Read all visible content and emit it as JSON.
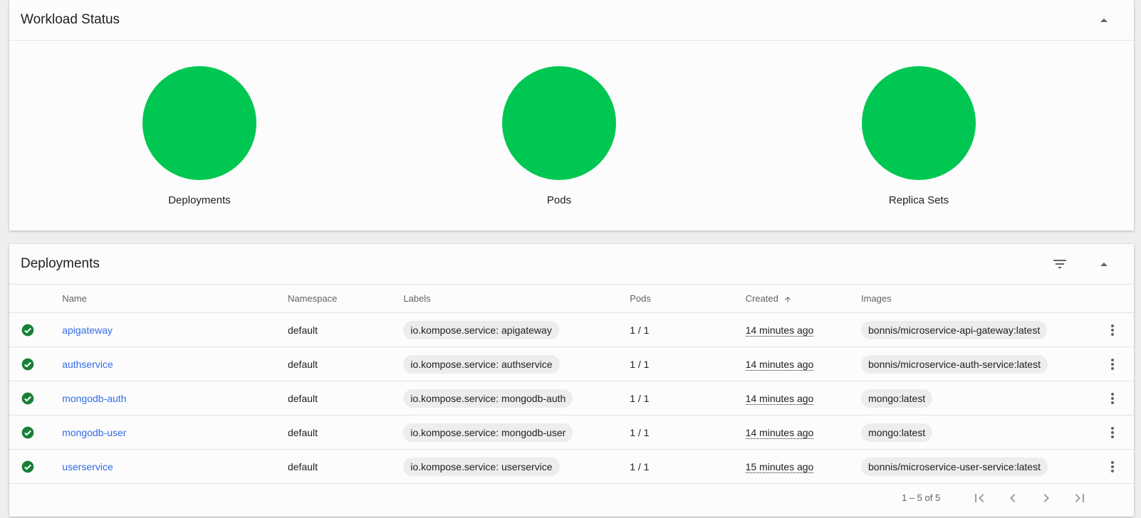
{
  "workload": {
    "title": "Workload Status",
    "status_color": "#00c752",
    "items": [
      {
        "label": "Deployments"
      },
      {
        "label": "Pods"
      },
      {
        "label": "Replica Sets"
      }
    ]
  },
  "deployments": {
    "title": "Deployments",
    "columns": {
      "name": "Name",
      "namespace": "Namespace",
      "labels": "Labels",
      "pods": "Pods",
      "created": "Created",
      "images": "Images"
    },
    "rows": [
      {
        "name": "apigateway",
        "namespace": "default",
        "label": "io.kompose.service: apigateway",
        "pods": "1 / 1",
        "created": "14 minutes ago",
        "image": "bonnis/microservice-api-gateway:latest"
      },
      {
        "name": "authservice",
        "namespace": "default",
        "label": "io.kompose.service: authservice",
        "pods": "1 / 1",
        "created": "14 minutes ago",
        "image": "bonnis/microservice-auth-service:latest"
      },
      {
        "name": "mongodb-auth",
        "namespace": "default",
        "label": "io.kompose.service: mongodb-auth",
        "pods": "1 / 1",
        "created": "14 minutes ago",
        "image": "mongo:latest"
      },
      {
        "name": "mongodb-user",
        "namespace": "default",
        "label": "io.kompose.service: mongodb-user",
        "pods": "1 / 1",
        "created": "14 minutes ago",
        "image": "mongo:latest"
      },
      {
        "name": "userservice",
        "namespace": "default",
        "label": "io.kompose.service: userservice",
        "pods": "1 / 1",
        "created": "15 minutes ago",
        "image": "bonnis/microservice-user-service:latest"
      }
    ],
    "paginator": {
      "range": "1 – 5 of 5"
    }
  },
  "colors": {
    "link": "#326de6",
    "ok": "#188038",
    "status_fill": "#00c752"
  },
  "icons": {
    "collapse": "arrow-drop-up-icon",
    "filter": "filter-icon",
    "status": "check-circle-icon",
    "menu": "more-vert-icon",
    "sort": "arrow-upward-icon",
    "pager": [
      "first-page-icon",
      "chevron-left-icon",
      "chevron-right-icon",
      "last-page-icon"
    ]
  }
}
